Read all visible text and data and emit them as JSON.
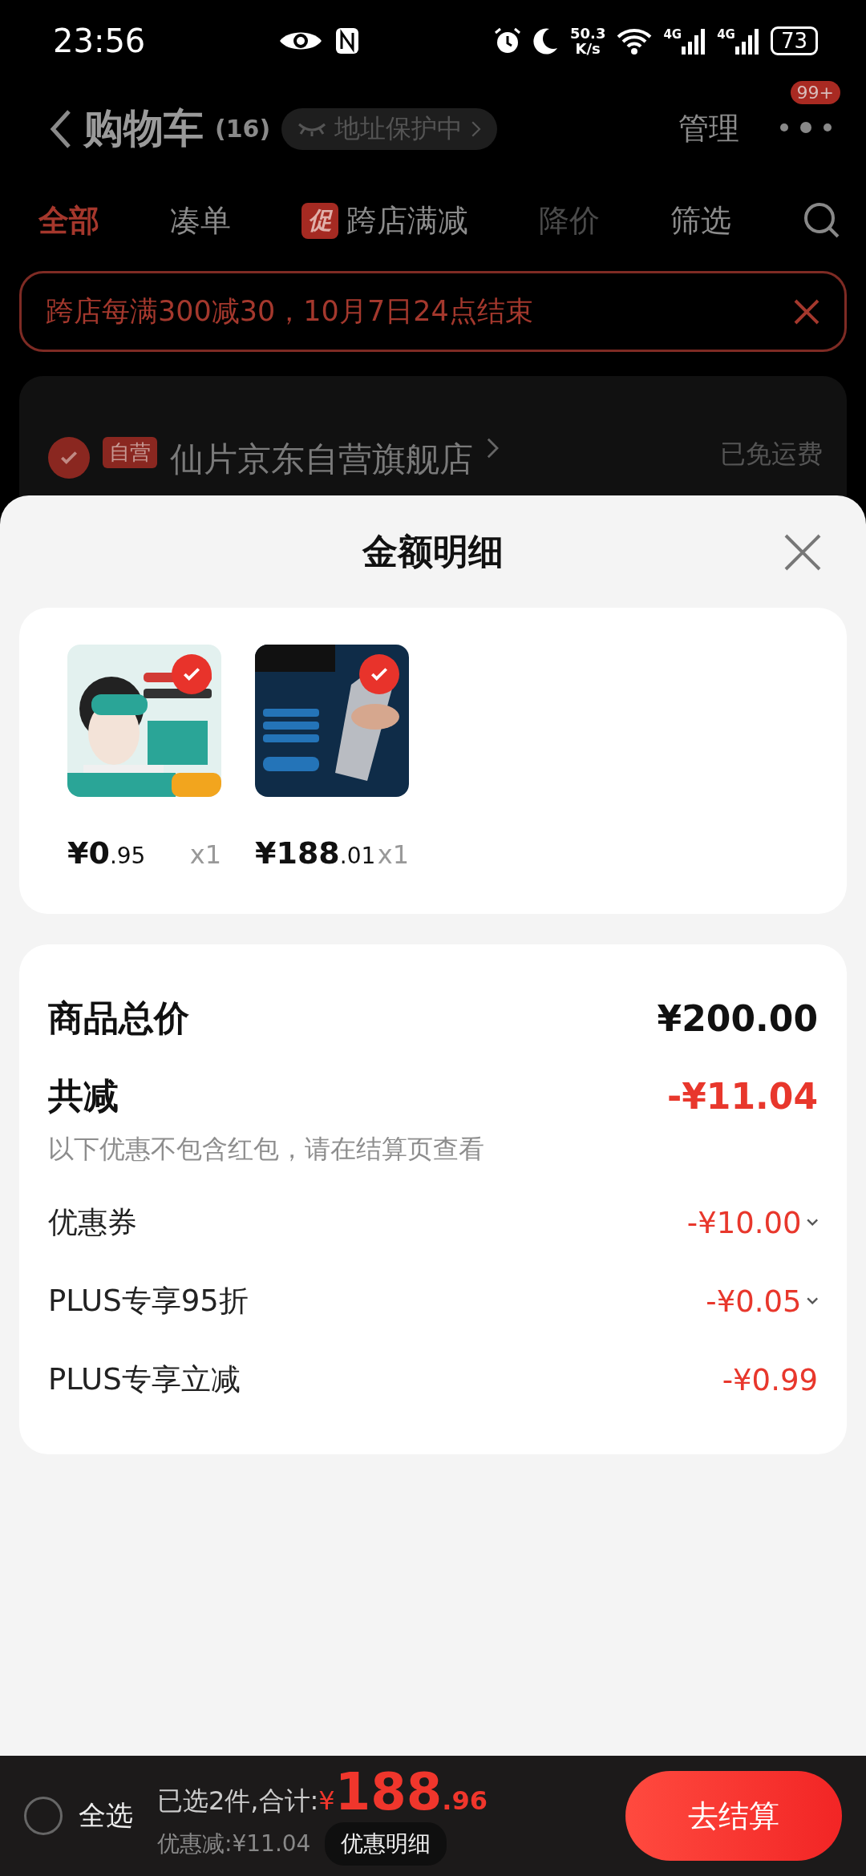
{
  "status_bar": {
    "time": "23:56",
    "speed": "50.3",
    "speed_unit": "K/s",
    "networks": [
      "4G",
      "4G"
    ],
    "battery": "73"
  },
  "header": {
    "title": "购物车",
    "count": "(16)",
    "address_pill": "地址保护中",
    "manage": "管理",
    "badge": "99+"
  },
  "tabs": [
    {
      "label": "全部",
      "selected": true,
      "disabled": false
    },
    {
      "label": "凑单",
      "selected": false,
      "disabled": false
    },
    {
      "label": "跨店满减",
      "tag": "促",
      "selected": false,
      "disabled": false
    },
    {
      "label": "降价",
      "selected": false,
      "disabled": true
    },
    {
      "label": "筛选",
      "selected": false,
      "disabled": false
    }
  ],
  "promo_banner": {
    "text": "跨店每满300减30，10月7日24点结束"
  },
  "store": {
    "checked": true,
    "tag": "自营",
    "name": "仙片京东自营旗舰店",
    "shipping": "已免运费"
  },
  "sheet": {
    "title": "金额明细",
    "products": [
      {
        "kind": "picture",
        "selected": true,
        "price_int": "¥0",
        "price_dec": ".95",
        "qty": "x1"
      },
      {
        "kind": "picture",
        "selected": true,
        "price_int": "¥188",
        "price_dec": ".01",
        "qty": "x1"
      }
    ],
    "total": {
      "label": "商品总价",
      "value": "¥200.00"
    },
    "discount": {
      "label": "共减",
      "value": "-¥11.04",
      "note": "以下优惠不包含红包，请在结算页查看"
    },
    "details": [
      {
        "label": "优惠券",
        "value": "-¥10.00",
        "expandable": true
      },
      {
        "label": "PLUS专享95折",
        "value": "-¥0.05",
        "expandable": true
      },
      {
        "label": "PLUS专享立减",
        "value": "-¥0.99",
        "expandable": false
      }
    ]
  },
  "bottom_bar": {
    "select_all": {
      "label": "全选",
      "checked": false
    },
    "selected_text": "已选2件,合计:",
    "currency": "¥",
    "total_int": "188",
    "total_dec": ".96",
    "saving": "优惠减:¥11.04",
    "detail_button": "优惠明细",
    "checkout": "去结算"
  }
}
